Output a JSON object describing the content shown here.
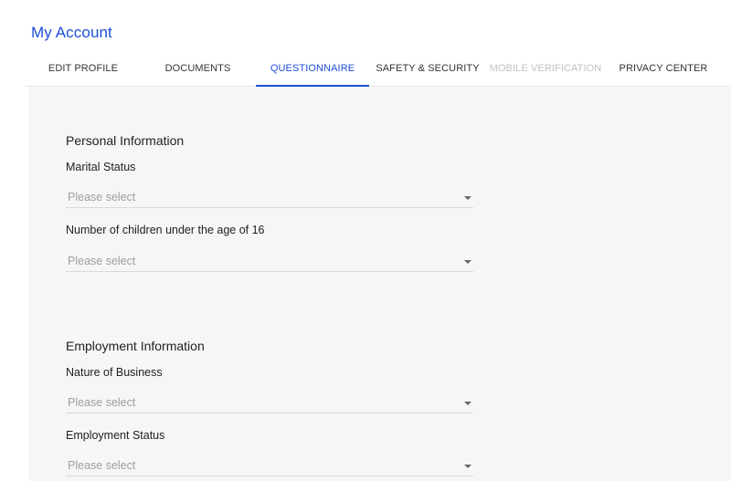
{
  "page": {
    "title": "My Account"
  },
  "tabs": [
    {
      "label": "EDIT PROFILE"
    },
    {
      "label": "DOCUMENTS"
    },
    {
      "label": "QUESTIONNAIRE"
    },
    {
      "label": "SAFETY & SECURITY"
    },
    {
      "label": "MOBILE VERIFICATION"
    },
    {
      "label": "PRIVACY CENTER"
    }
  ],
  "active_tab": "QUESTIONNAIRE",
  "disabled_tab": "MOBILE VERIFICATION",
  "colors": {
    "accent": "#1e4fd8",
    "panel_bg": "#f6f6f6",
    "placeholder": "#9e9e9e"
  },
  "personal": {
    "title": "Personal Information",
    "marital_status": {
      "label": "Marital Status",
      "placeholder": "Please select"
    },
    "children": {
      "label": "Number of children under the age of 16",
      "placeholder": "Please select"
    }
  },
  "employment": {
    "title": "Employment Information",
    "nature_of_business": {
      "label": "Nature of Business",
      "placeholder": "Please select"
    },
    "employment_status": {
      "label": "Employment Status",
      "placeholder": "Please select"
    }
  }
}
